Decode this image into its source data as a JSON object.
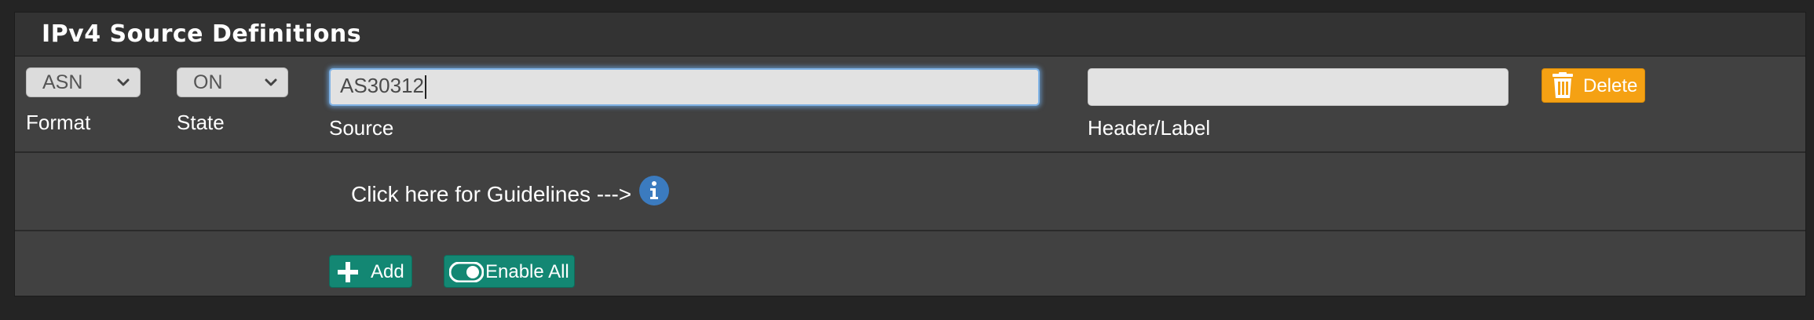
{
  "panel": {
    "title": "IPv4 Source Definitions"
  },
  "row": {
    "format": {
      "label": "Format",
      "selected": "ASN"
    },
    "state": {
      "label": "State",
      "selected": "ON"
    },
    "source": {
      "label": "Source",
      "value": "AS30312"
    },
    "header": {
      "label": "Header/Label",
      "value": ""
    },
    "delete_label": "Delete"
  },
  "guidelines": {
    "text": "Click here for Guidelines --->",
    "icon": "info-circle-icon"
  },
  "actions": {
    "add_label": "Add",
    "enable_all_label": "Enable All"
  },
  "colors": {
    "accent_teal": "#138773",
    "delete_orange": "#f5a113",
    "info_blue": "#3b7bbf",
    "panel_bg": "#414141",
    "heading_bg": "#333333"
  }
}
